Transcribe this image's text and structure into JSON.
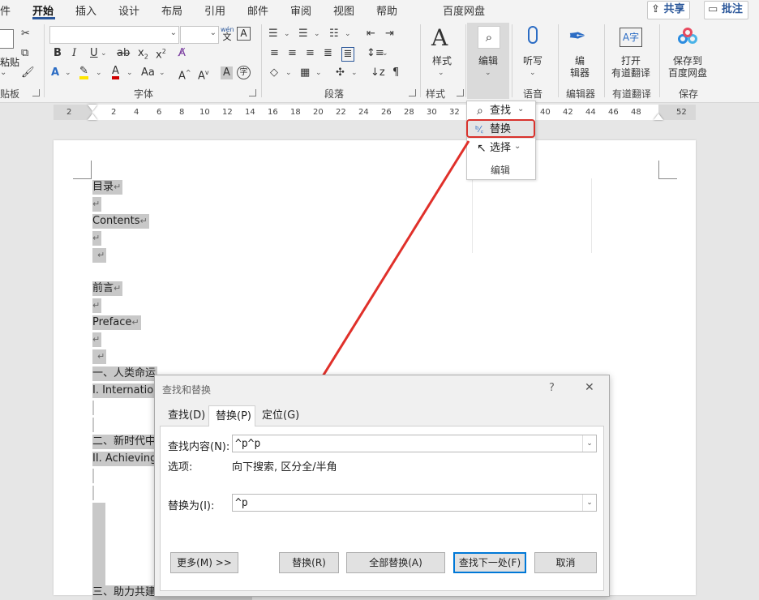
{
  "tabs": {
    "file": "件",
    "home": "开始",
    "insert": "插入",
    "design": "设计",
    "layout": "布局",
    "references": "引用",
    "mailings": "邮件",
    "review": "审阅",
    "view": "视图",
    "help": "帮助",
    "baidu": "百度网盘"
  },
  "top_buttons": {
    "share": "共享",
    "comment": "批注"
  },
  "ribbon": {
    "clipboard": {
      "paste": "粘贴",
      "label": "贴板"
    },
    "font": {
      "label": "字体",
      "wen_top": "wén",
      "wen_bottom": "文",
      "A_box": "A"
    },
    "paragraph": {
      "label": "段落"
    },
    "styles": {
      "button": "样式",
      "label": "样式"
    },
    "editing": {
      "button": "编辑"
    },
    "voice": {
      "button": "听写",
      "label": "语音"
    },
    "editor": {
      "button_line1": "编",
      "button_line2": "辑器",
      "label": "编辑器"
    },
    "youdao": {
      "button_line1": "打开",
      "button_line2": "有道翻译",
      "label": "有道翻译"
    },
    "save": {
      "button_line1": "保存到",
      "button_line2": "百度网盘",
      "label": "保存"
    }
  },
  "ruler": {
    "numbers": [
      "2",
      "2",
      "4",
      "6",
      "8",
      "10",
      "12",
      "14",
      "16",
      "18",
      "20",
      "22",
      "24",
      "26",
      "28",
      "30",
      "32",
      "40",
      "42",
      "44",
      "46",
      "48",
      "52"
    ]
  },
  "document": {
    "lines": [
      {
        "text": "目录"
      },
      {
        "text": ""
      },
      {
        "text": "Contents"
      },
      {
        "text": ""
      },
      {
        "text": ""
      },
      {
        "text": "前言"
      },
      {
        "text": ""
      },
      {
        "text": "Preface"
      },
      {
        "text": ""
      },
      {
        "text": ""
      },
      {
        "text": "一、人类命运"
      },
      {
        "text": "I. Internationa"
      },
      {
        "text": ""
      },
      {
        "text": ""
      },
      {
        "text": "二、新时代中"
      },
      {
        "text": "II. Achieving"
      },
      {
        "text": ""
      },
      {
        "text": ""
      },
      {
        "text": "三、助力共建“一带一路”国际合作"
      }
    ],
    "para_mark": "↵"
  },
  "dropdown": {
    "find": "查找",
    "replace": "替换",
    "select": "选择",
    "group_label": "编辑"
  },
  "dialog": {
    "title": "查找和替换",
    "help": "?",
    "close": "✕",
    "tabs": {
      "find": "查找(D)",
      "replace": "替换(P)",
      "goto": "定位(G)"
    },
    "find_label": "查找内容(N):",
    "find_value": "^p^p",
    "options_label": "选项:",
    "options_value": "向下搜索, 区分全/半角",
    "replace_label": "替换为(I):",
    "replace_value": "^p",
    "buttons": {
      "more": "更多(M) >>",
      "replace": "替换(R)",
      "replace_all": "全部替换(A)",
      "find_next": "查找下一处(F)",
      "cancel": "取消"
    }
  },
  "colors": {
    "accent": "#2b579a",
    "highlight_red": "#d9322c",
    "selection_gray": "#c8c8c8"
  }
}
